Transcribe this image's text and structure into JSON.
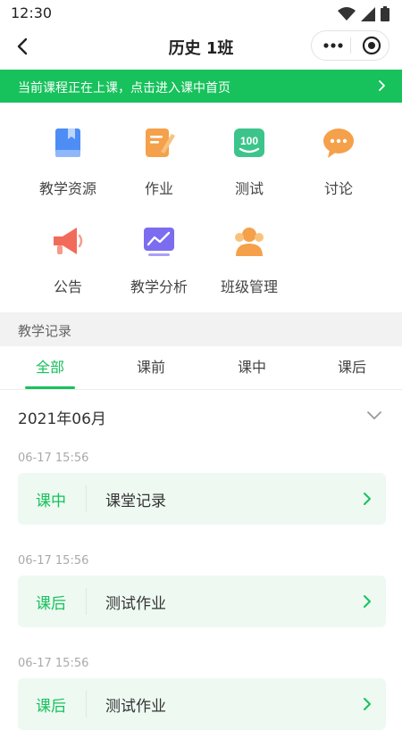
{
  "status": {
    "time": "12:30"
  },
  "nav": {
    "title": "历史 1班"
  },
  "banner": {
    "text": "当前课程正在上课，点击进入课中首页"
  },
  "menu": [
    {
      "label": "教学资源",
      "icon": "book-icon",
      "color": "#4e8df5"
    },
    {
      "label": "作业",
      "icon": "edit-note-icon",
      "color": "#f5a04a"
    },
    {
      "label": "测试",
      "icon": "score-100-icon",
      "color": "#3cc48a"
    },
    {
      "label": "讨论",
      "icon": "chat-bubble-icon",
      "color": "#f5a04a"
    },
    {
      "label": "公告",
      "icon": "megaphone-icon",
      "color": "#f26b5a"
    },
    {
      "label": "教学分析",
      "icon": "analysis-chart-icon",
      "color": "#7b6cf0"
    },
    {
      "label": "班级管理",
      "icon": "group-icon",
      "color": "#f5a04a"
    }
  ],
  "section": {
    "title": "教学记录"
  },
  "tabs": [
    "全部",
    "课前",
    "课中",
    "课后"
  ],
  "month": "2021年06月",
  "records": [
    {
      "time": "06-17 15:56",
      "phase": "课中",
      "title": "课堂记录"
    },
    {
      "time": "06-17 15:56",
      "phase": "课后",
      "title": "测试作业"
    },
    {
      "time": "06-17 15:56",
      "phase": "课后",
      "title": "测试作业"
    }
  ],
  "colors": {
    "accent": "#17c15c",
    "card_bg": "#eef9f2"
  }
}
